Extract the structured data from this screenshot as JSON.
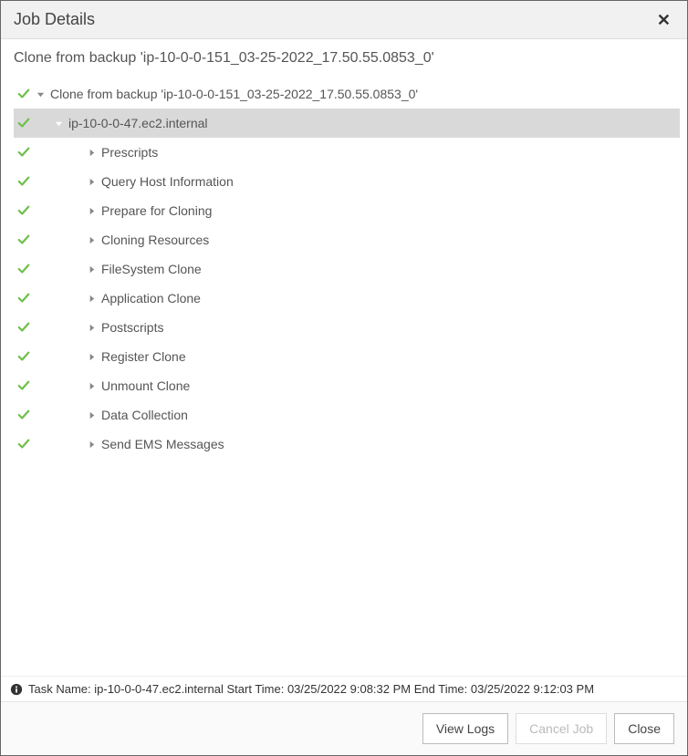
{
  "header": {
    "title": "Job Details"
  },
  "job": {
    "title": "Clone from backup 'ip-10-0-0-151_03-25-2022_17.50.55.0853_0'"
  },
  "tree": {
    "root": {
      "label": "Clone from backup 'ip-10-0-0-151_03-25-2022_17.50.55.0853_0'"
    },
    "host": {
      "label": "ip-10-0-0-47.ec2.internal"
    },
    "steps": [
      {
        "label": "Prescripts"
      },
      {
        "label": "Query Host Information"
      },
      {
        "label": "Prepare for Cloning"
      },
      {
        "label": "Cloning Resources"
      },
      {
        "label": "FileSystem Clone"
      },
      {
        "label": "Application Clone"
      },
      {
        "label": "Postscripts"
      },
      {
        "label": "Register Clone"
      },
      {
        "label": "Unmount Clone"
      },
      {
        "label": "Data Collection"
      },
      {
        "label": "Send EMS Messages"
      }
    ]
  },
  "status": {
    "text": "Task Name: ip-10-0-0-47.ec2.internal Start Time: 03/25/2022 9:08:32 PM End Time: 03/25/2022 9:12:03 PM"
  },
  "footer": {
    "view_logs": "View Logs",
    "cancel_job": "Cancel Job",
    "close": "Close"
  }
}
